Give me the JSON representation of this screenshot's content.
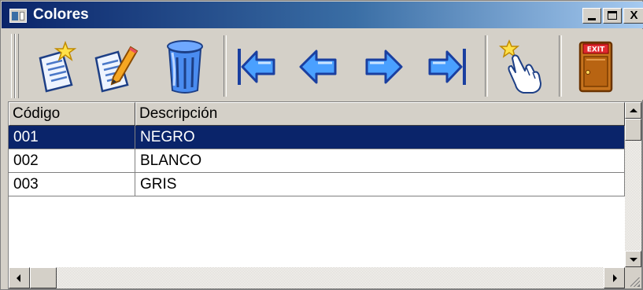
{
  "window": {
    "title": "Colores",
    "controls": {
      "minimize": "_",
      "maximize": "□",
      "close": "X"
    }
  },
  "toolbar": {
    "buttons": [
      {
        "name": "new-record",
        "icon": "new-document-star-icon"
      },
      {
        "name": "edit-record",
        "icon": "edit-document-pencil-icon"
      },
      {
        "name": "delete-record",
        "icon": "trash-can-icon"
      },
      {
        "name": "first-record",
        "icon": "arrow-first-icon"
      },
      {
        "name": "previous-record",
        "icon": "arrow-left-icon"
      },
      {
        "name": "next-record",
        "icon": "arrow-right-icon"
      },
      {
        "name": "last-record",
        "icon": "arrow-last-icon"
      },
      {
        "name": "select-record",
        "icon": "pointing-hand-star-icon"
      },
      {
        "name": "exit",
        "icon": "exit-door-icon",
        "label": "EXIT"
      }
    ]
  },
  "grid": {
    "columns": [
      "Código",
      "Descripción"
    ],
    "rows": [
      {
        "codigo": "001",
        "descripcion": "NEGRO",
        "selected": true
      },
      {
        "codigo": "002",
        "descripcion": "BLANCO",
        "selected": false
      },
      {
        "codigo": "003",
        "descripcion": "GRIS",
        "selected": false
      }
    ]
  },
  "colors": {
    "title_start": "#0a246a",
    "title_end": "#a6caf0",
    "selection": "#0a246a",
    "face": "#d4d0c8",
    "nav_blue": "#1a5fd0"
  }
}
